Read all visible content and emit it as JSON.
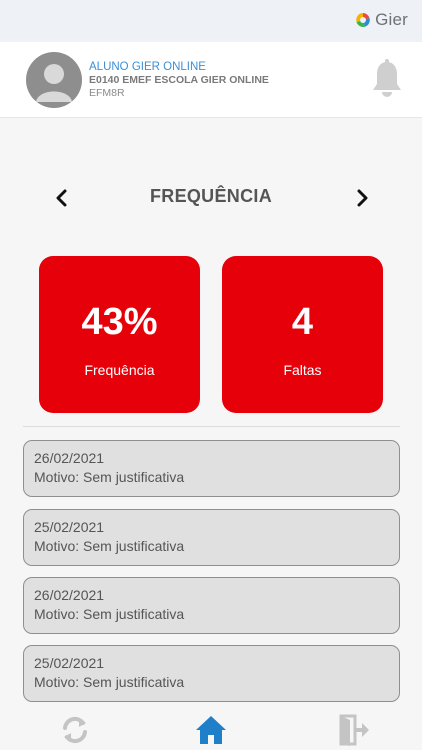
{
  "brand": {
    "name": "Gier",
    "logo_icon": "gier-logo-icon"
  },
  "profile": {
    "student_name": "ALUNO GIER ONLINE",
    "school": "E0140 EMEF ESCOLA GIER ONLINE",
    "class_code": "EFM8R",
    "avatar_icon": "avatar-icon",
    "notifications_icon": "bell-icon"
  },
  "page": {
    "title": "FREQUÊNCIA",
    "prev_icon": "chevron-left-icon",
    "next_icon": "chevron-right-icon"
  },
  "stats": [
    {
      "value": "43%",
      "label": "Frequência"
    },
    {
      "value": "4",
      "label": "Faltas"
    }
  ],
  "absences": [
    {
      "date": "26/02/2021",
      "reason": "Motivo: Sem justificativa"
    },
    {
      "date": "25/02/2021",
      "reason": "Motivo: Sem justificativa"
    },
    {
      "date": "26/02/2021",
      "reason": "Motivo: Sem justificativa"
    },
    {
      "date": "25/02/2021",
      "reason": "Motivo: Sem justificativa"
    }
  ],
  "bottom_nav": [
    {
      "icon": "refresh-icon",
      "active": false
    },
    {
      "icon": "home-icon",
      "active": true
    },
    {
      "icon": "logout-icon",
      "active": false
    }
  ],
  "colors": {
    "accent_red": "#e5000a",
    "link_blue": "#3a8fd8",
    "home_active": "#1f7fc9",
    "icon_gray": "#c4c4c4"
  }
}
